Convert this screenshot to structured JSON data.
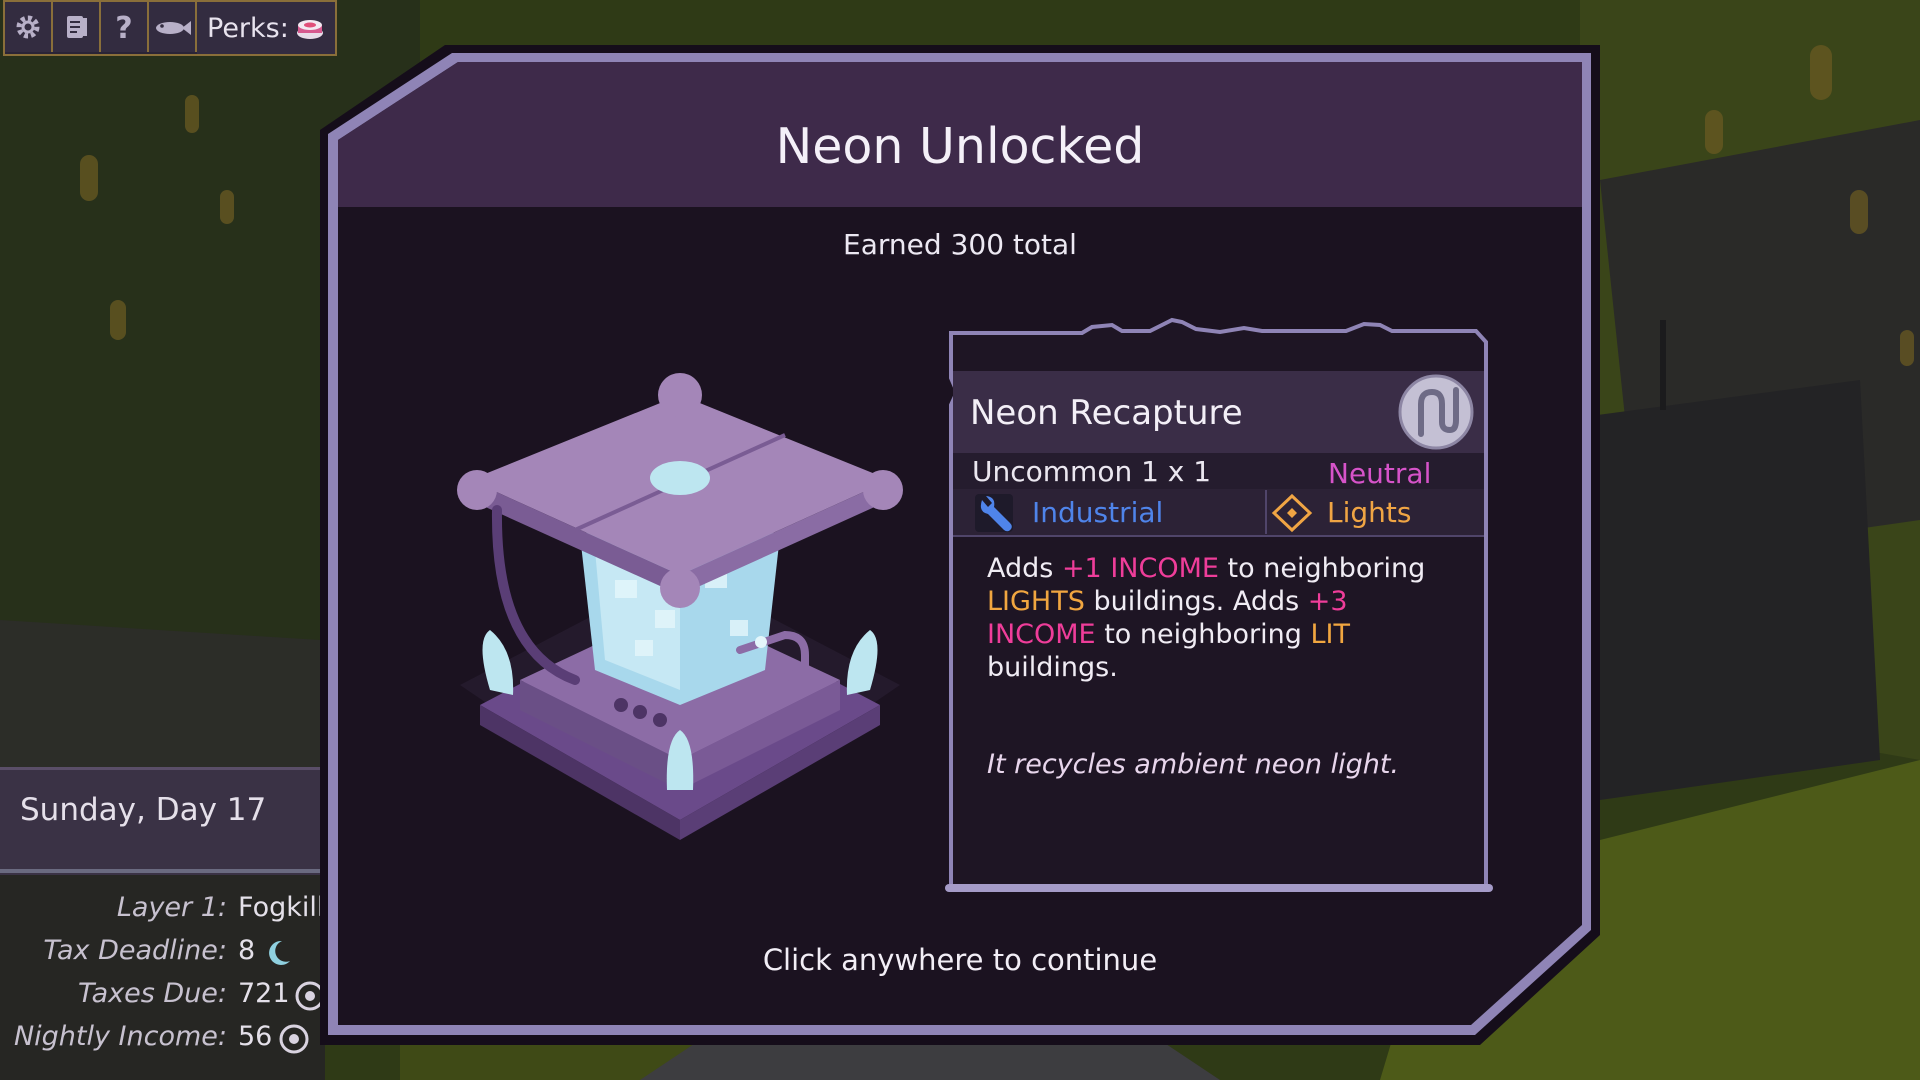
{
  "toolbar": {
    "buttons": [
      {
        "name": "settings-button",
        "icon": "gear-icon"
      },
      {
        "name": "notes-button",
        "icon": "notes-icon"
      },
      {
        "name": "help-button",
        "icon": "question-icon"
      },
      {
        "name": "fish-button",
        "icon": "fish-icon"
      }
    ],
    "perks_label": "Perks:",
    "perks_icon": "cake-icon"
  },
  "date_panel": {
    "date": "Sunday, Day 17"
  },
  "stats": [
    {
      "label": "Layer 1:",
      "value": "Fogkill",
      "icon": ""
    },
    {
      "label": "Tax Deadline:",
      "value": "8",
      "icon": "moon-icon"
    },
    {
      "label": "Taxes Due:",
      "value": "721",
      "icon": "coin-icon"
    },
    {
      "label": "Nightly Income:",
      "value": "56",
      "icon": "coin-icon"
    }
  ],
  "modal": {
    "title": "Neon Unlocked",
    "subtitle": "Earned 300 total",
    "continue_text": "Click anywhere to continue",
    "card": {
      "name": "Neon Recapture",
      "emblem_icon": "neon-emblem-icon",
      "rarity_size": "Uncommon 1 x 1",
      "alignment": "Neutral",
      "tags": [
        {
          "label": "Industrial",
          "icon": "wrench-icon",
          "color": "#4f84ea"
        },
        {
          "label": "Lights",
          "icon": "lights-diamond-icon",
          "color": "#f0a544"
        }
      ],
      "description_parts": [
        {
          "text": "Adds ",
          "style": "normal"
        },
        {
          "text": "+1 INCOME",
          "style": "income"
        },
        {
          "text": " to neighboring ",
          "style": "normal"
        },
        {
          "text": "LIGHTS",
          "style": "lights"
        },
        {
          "text": " buildings. Adds ",
          "style": "normal"
        },
        {
          "text": "+3 INCOME",
          "style": "income"
        },
        {
          "text": " to neighboring ",
          "style": "normal"
        },
        {
          "text": "LIT",
          "style": "lights"
        },
        {
          "text": " buildings.",
          "style": "normal"
        }
      ],
      "flavor": "It recycles ambient neon light."
    }
  },
  "colors": {
    "modal_frame": "#9286b8",
    "modal_header": "#3e2a4a",
    "modal_body": "#1b1220",
    "income": "#ef3d9a",
    "lights": "#f1a640",
    "neutral": "#d653c9",
    "industrial": "#4f84ea"
  }
}
